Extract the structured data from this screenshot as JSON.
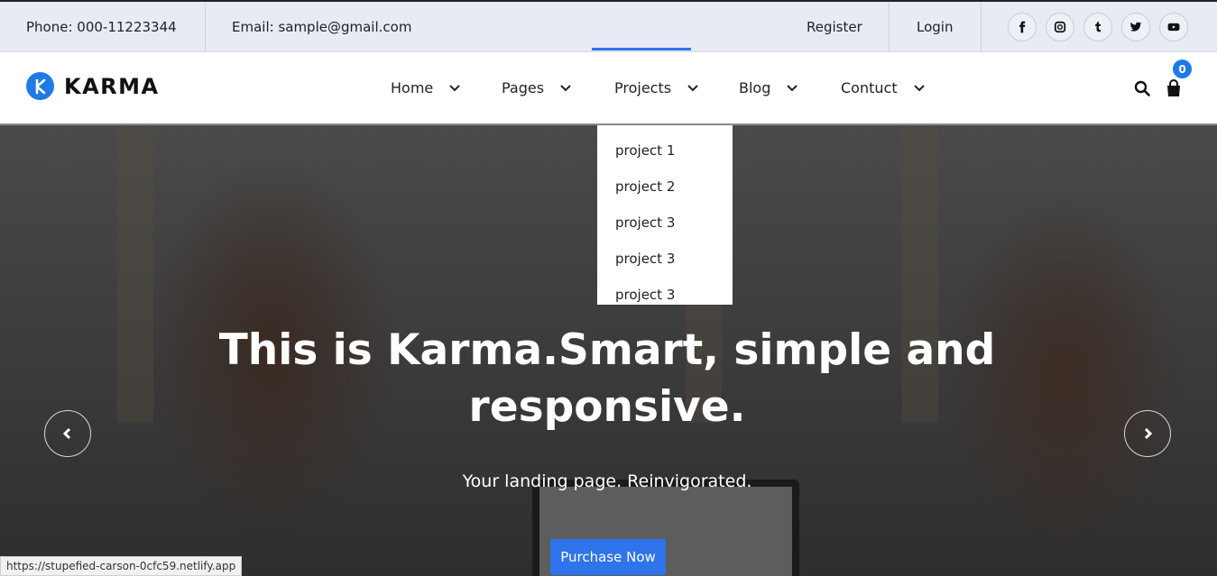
{
  "topbar": {
    "phone": "Phone: 000-11223344",
    "email": "Email: sample@gmail.com",
    "register": "Register",
    "login": "Login",
    "socials": [
      "facebook-icon",
      "instagram-icon",
      "tumblr-icon",
      "twitter-icon",
      "youtube-icon"
    ]
  },
  "brand": {
    "name": "KARMA",
    "logo_icon": "k-logo-icon",
    "color": "#1f7ae8"
  },
  "nav": {
    "items": [
      {
        "label": "Home"
      },
      {
        "label": "Pages"
      },
      {
        "label": "Projects"
      },
      {
        "label": "Blog"
      },
      {
        "label": "Contuct"
      }
    ],
    "active": "Projects",
    "cart_count": "0",
    "accent": "#2f74ea"
  },
  "dropdown": {
    "items": [
      "project 1",
      "project 2",
      "project 3",
      "project 3",
      "project 3"
    ]
  },
  "hero": {
    "title": "This is Karma.Smart, simple and responsive.",
    "subtitle": "Your landing page. Reinvigorated.",
    "cta": "Purchase Now"
  },
  "status_url": "https://stupefied-carson-0cfc59.netlify.app"
}
